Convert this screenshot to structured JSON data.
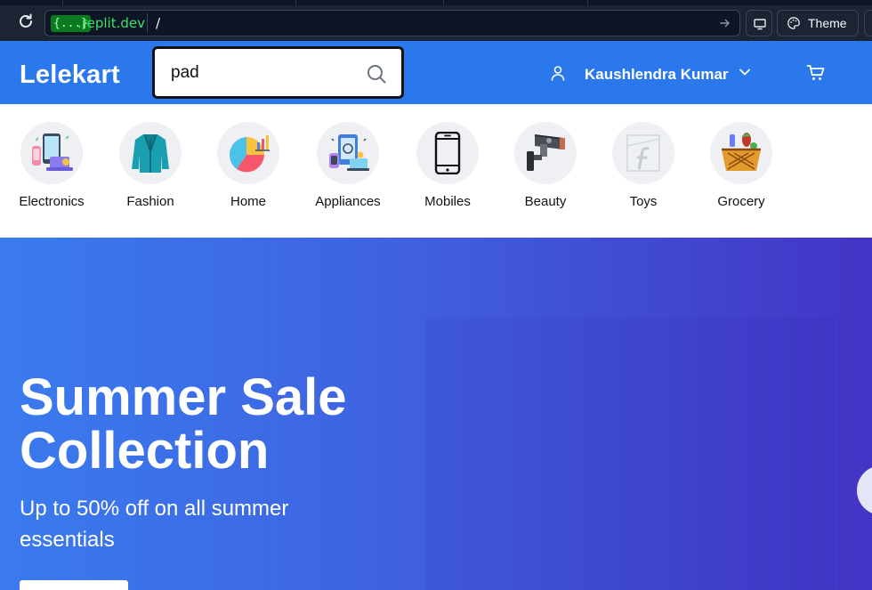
{
  "browser": {
    "replit_badge": "{...}",
    "replit_host": ".replit.dev",
    "url_path": "/",
    "theme_label": "Theme"
  },
  "header": {
    "logo": "Lelekart",
    "search": {
      "value": "pad",
      "placeholder": ""
    },
    "user_name": "Kaushlendra Kumar"
  },
  "categories": [
    {
      "label": "Electronics",
      "icon": "electronics-icon"
    },
    {
      "label": "Fashion",
      "icon": "blazer-icon"
    },
    {
      "label": "Home",
      "icon": "pie-chart-icon"
    },
    {
      "label": "Appliances",
      "icon": "appliances-icon"
    },
    {
      "label": "Mobiles",
      "icon": "smartphone-icon"
    },
    {
      "label": "Beauty",
      "icon": "cctv-camera-icon"
    },
    {
      "label": "Toys",
      "icon": "placeholder-f-icon"
    },
    {
      "label": "Grocery",
      "icon": "grocery-basket-icon"
    }
  ],
  "hero": {
    "title": "Summer Sale Collection",
    "subtitle": "Up to 50% off on all summer essentials"
  },
  "colors": {
    "brand_blue": "#2a78ec",
    "hero_start": "#3a7bee",
    "hero_end": "#4334c5",
    "chrome_bg": "#1c2333"
  }
}
